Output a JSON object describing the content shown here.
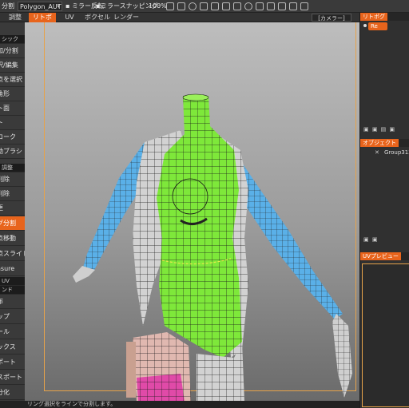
{
  "toolbar": {
    "left_cut": "分割",
    "mode_value": "Polygon_AUT",
    "mirror_label": "ミラー反転",
    "snapping_label": "ミラースナッピング:",
    "snapping_value": "100%"
  },
  "tabs": [
    {
      "label": "調整",
      "active": false
    },
    {
      "label": "リトポ",
      "active": true
    },
    {
      "label": "UV",
      "active": false
    },
    {
      "label": "ボクセル",
      "active": false
    },
    {
      "label": "レンダー",
      "active": false
    }
  ],
  "camera_dropdown": "[カメラー]",
  "left_panel": {
    "items": [
      {
        "label": "シック",
        "type": "header"
      },
      {
        "label": "加/分割",
        "type": "item"
      },
      {
        "label": "択/編集",
        "type": "item"
      },
      {
        "label": "点を選択",
        "type": "item"
      },
      {
        "label": "角形",
        "type": "item"
      },
      {
        "label": "ト面",
        "type": "item"
      },
      {
        "label": "ト",
        "type": "item"
      },
      {
        "label": "ローク",
        "type": "item"
      },
      {
        "label": "動ブラシ",
        "type": "item"
      },
      {
        "label": "調整",
        "type": "header"
      },
      {
        "label": "削除",
        "type": "item"
      },
      {
        "label": "削除",
        "type": "item"
      },
      {
        "label": "更",
        "type": "item"
      },
      {
        "label": "グ分割",
        "type": "active"
      },
      {
        "label": "点移動",
        "type": "item"
      },
      {
        "label": "点スライド",
        "type": "item"
      },
      {
        "label": "asure",
        "type": "item"
      },
      {
        "label": "UV",
        "type": "header"
      },
      {
        "label": "ンド",
        "type": "header"
      },
      {
        "label": "布",
        "type": "item"
      },
      {
        "label": "ップ",
        "type": "item"
      },
      {
        "label": "ール",
        "type": "item"
      },
      {
        "label": "ックス",
        "type": "item"
      },
      {
        "label": "ポート",
        "type": "item"
      },
      {
        "label": "スポート",
        "type": "item"
      },
      {
        "label": "分化",
        "type": "item"
      }
    ]
  },
  "status_text": "リング選択をラインで分割します。",
  "right_panel": {
    "retopo_title": "リトポグ",
    "retopo_item": "Re",
    "objects_title": "オブジェクト",
    "object_name": "Group312",
    "uv_preview_title": "UVプレビュー"
  },
  "colors": {
    "accent": "#e8641c",
    "mesh_green": "#7ee83a",
    "mesh_blue": "#5ab0e8",
    "mesh_gray": "#c8c8c8",
    "mesh_pink": "#e04aa8"
  }
}
